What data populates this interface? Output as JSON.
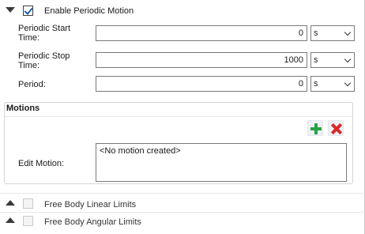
{
  "periodic": {
    "enable_label": "Enable Periodic Motion",
    "enabled": true,
    "rows": [
      {
        "label_line1": "Periodic Start",
        "label_line2": "Time:",
        "value": "0",
        "unit": "s"
      },
      {
        "label_line1": "Periodic Stop",
        "label_line2": "Time:",
        "value": "1000",
        "unit": "s"
      },
      {
        "label_line1": "Period:",
        "label_line2": "",
        "value": "0",
        "unit": "s"
      }
    ]
  },
  "motions": {
    "title": "Motions",
    "edit_label": "Edit Motion:",
    "list_text": "<No motion created>",
    "add_icon": "plus-icon",
    "delete_icon": "x-icon",
    "colors": {
      "add": "#27a243",
      "delete": "#d72a2a"
    }
  },
  "limits": [
    {
      "label": "Free Body Linear Limits",
      "checked": false
    },
    {
      "label": "Free Body Angular Limits",
      "checked": false
    }
  ]
}
